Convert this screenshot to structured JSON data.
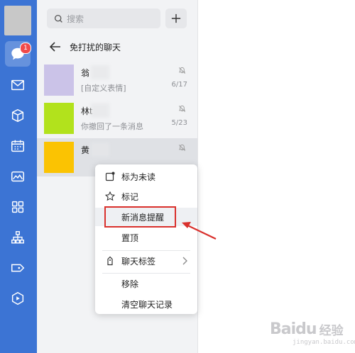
{
  "rail": {
    "badge_count": "1",
    "icons": [
      "chat-icon",
      "mail-icon",
      "cube-icon",
      "calendar-icon",
      "gallery-icon",
      "apps-icon",
      "org-icon",
      "tag-icon",
      "hexagon-icon"
    ]
  },
  "search": {
    "placeholder": "搜索",
    "add_label": "+"
  },
  "header": {
    "title": "免打扰的聊天"
  },
  "conversations": [
    {
      "name": "翁",
      "message": "[自定义表情]",
      "date": "6/17",
      "color": "#cbc3e8"
    },
    {
      "name": "林t",
      "message": "你撤回了一条消息",
      "date": "5/23",
      "color": "#b2e21c"
    },
    {
      "name": "黄",
      "message": "",
      "date": "",
      "color": "#fbc302"
    }
  ],
  "context_menu": {
    "items": [
      {
        "label": "标为未读",
        "icon": "unread-icon"
      },
      {
        "label": "标记",
        "icon": "star-icon"
      },
      {
        "label": "新消息提醒",
        "icon": ""
      },
      {
        "label": "置顶",
        "icon": ""
      },
      {
        "label": "聊天标签",
        "icon": "tag-icon"
      },
      {
        "label": "移除",
        "icon": ""
      },
      {
        "label": "清空聊天记录",
        "icon": ""
      }
    ]
  },
  "watermark": {
    "brand": "Bai",
    "brand2": "du",
    "cn": "经验",
    "sub": "jingyan.baidu.com"
  },
  "colors": {
    "rail": "#3c74d4",
    "highlight": "#d9302c",
    "badge": "#f04a4a"
  }
}
